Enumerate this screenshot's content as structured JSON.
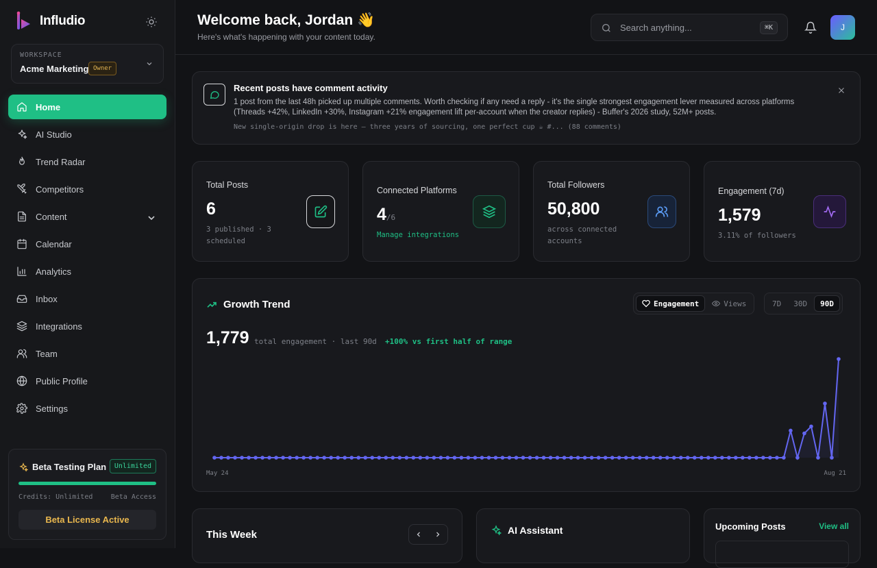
{
  "app": {
    "name": "Infludio"
  },
  "workspace": {
    "label": "WORKSPACE",
    "name": "Acme Marketing",
    "role": "Owner"
  },
  "nav": [
    {
      "label": "Home",
      "icon": "home-icon",
      "active": true
    },
    {
      "label": "AI Studio",
      "icon": "sparkles-icon"
    },
    {
      "label": "Trend Radar",
      "icon": "flame-icon"
    },
    {
      "label": "Competitors",
      "icon": "swords-icon"
    },
    {
      "label": "Content",
      "icon": "document-icon",
      "expandable": true
    },
    {
      "label": "Calendar",
      "icon": "calendar-icon"
    },
    {
      "label": "Analytics",
      "icon": "bar-chart-icon"
    },
    {
      "label": "Inbox",
      "icon": "inbox-icon"
    },
    {
      "label": "Integrations",
      "icon": "layers-icon"
    },
    {
      "label": "Team",
      "icon": "users-icon"
    },
    {
      "label": "Public Profile",
      "icon": "globe-icon"
    },
    {
      "label": "Settings",
      "icon": "gear-icon"
    }
  ],
  "plan": {
    "title": "Beta Testing Plan",
    "badge": "Unlimited",
    "credits": "Credits: Unlimited",
    "access": "Beta Access",
    "button": "Beta License Active",
    "progress": 1
  },
  "header": {
    "title": "Welcome back, Jordan",
    "emoji": "👋",
    "subtitle": "Here's what's happening with your content today.",
    "search_placeholder": "Search anything...",
    "shortcut": "⌘K",
    "avatar_initial": "J"
  },
  "alert": {
    "title": "Recent posts have comment activity",
    "body": "1 post from the last 48h picked up multiple comments. Worth checking if any need a reply - it's the single strongest engagement lever measured across platforms (Threads +42%, LinkedIn +30%, Instagram +21% engagement lift per-account when the creator replies) - Buffer's 2026 study, 52M+ posts.",
    "quote": "New single-origin drop is here — three years of sourcing, one perfect cup ☕ #... (88 comments)"
  },
  "stats": [
    {
      "label": "Total Posts",
      "value": "6",
      "sub": "3 published · 3 scheduled",
      "icon": "edit-icon"
    },
    {
      "label": "Connected Platforms",
      "value": "4",
      "value_suffix": "/6",
      "sub": "Manage integrations",
      "icon": "layers-icon"
    },
    {
      "label": "Total Followers",
      "value": "50,800",
      "sub": "across connected accounts",
      "icon": "users-icon"
    },
    {
      "label": "Engagement (7d)",
      "value": "1,579",
      "sub": "3.11% of followers",
      "icon": "activity-icon"
    }
  ],
  "growth": {
    "title": "Growth Trend",
    "metric_tabs": [
      {
        "label": "Engagement",
        "active": true
      },
      {
        "label": "Views",
        "active": false
      }
    ],
    "range_tabs": [
      {
        "label": "7D",
        "active": false
      },
      {
        "label": "30D",
        "active": false
      },
      {
        "label": "90D",
        "active": true
      }
    ],
    "total": "1,779",
    "total_desc": "total engagement · last 90d",
    "delta": "+100% vs first half of range"
  },
  "chart_data": {
    "type": "line",
    "x_start_label": "May 24",
    "x_end_label": "Aug 21",
    "series": [
      {
        "values": [
          0,
          0,
          0,
          0,
          0,
          0,
          0,
          0,
          0,
          0,
          0,
          0,
          0,
          0,
          0,
          0,
          0,
          0,
          0,
          0,
          0,
          0,
          0,
          0,
          0,
          0,
          0,
          0,
          0,
          0,
          0,
          0,
          0,
          0,
          0,
          0,
          0,
          0,
          0,
          0,
          0,
          0,
          0,
          0,
          0,
          0,
          0,
          0,
          0,
          0,
          0,
          0,
          0,
          0,
          0,
          0,
          0,
          0,
          0,
          0,
          0,
          0,
          0,
          0,
          0,
          0,
          0,
          0,
          0,
          0,
          0,
          0,
          0,
          0,
          0,
          0,
          0,
          0,
          0,
          0,
          0,
          0,
          0,
          0,
          390,
          0,
          350,
          450,
          0,
          780,
          0,
          1420
        ]
      }
    ],
    "ylim": [
      0,
      1420
    ],
    "grid": false,
    "color": "#6366f1"
  },
  "week": {
    "title": "This Week"
  },
  "assistant": {
    "title": "AI Assistant"
  },
  "upcoming": {
    "title": "Upcoming Posts",
    "link": "View all"
  }
}
